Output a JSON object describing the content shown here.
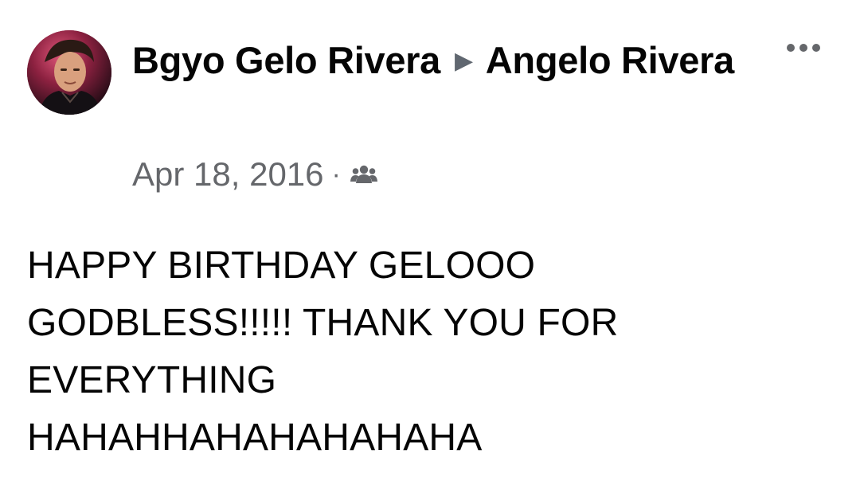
{
  "post": {
    "author": "Bgyo Gelo Rivera",
    "recipient": "Angelo Rivera",
    "separator_icon": "triangle-right-icon",
    "date": "Apr 18, 2016",
    "meta_dot": "·",
    "audience_icon": "friends-icon",
    "more_icon": "more-horizontal-icon",
    "text": "HAPPY BIRTHDAY GELOOO\nGODBLESS!!!!! THANK YOU FOR\nEVERYTHING\nHAHAHHAHAHAHAHAHA"
  },
  "colors": {
    "primary_text": "#050505",
    "secondary_text": "#65676b",
    "icon_gray": "#606770"
  }
}
